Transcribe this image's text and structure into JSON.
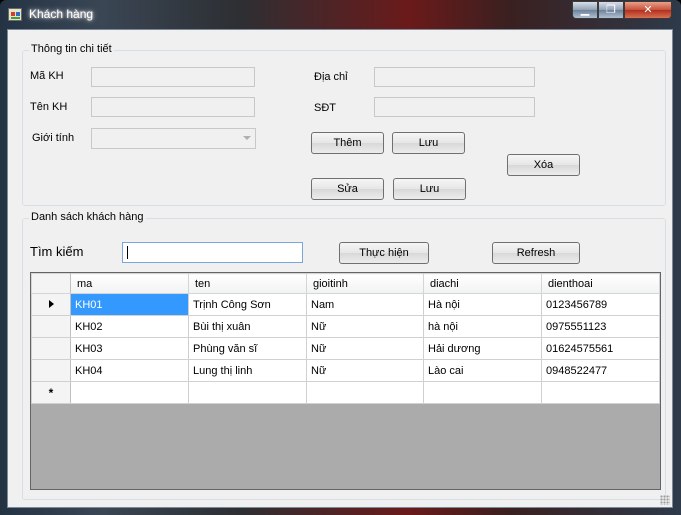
{
  "window": {
    "title": "Khách hàng",
    "caption_buttons": {
      "minimize": "▁",
      "maximize": "❐",
      "close": "✕"
    }
  },
  "details": {
    "group_title": "Thông tin chi tiết",
    "labels": {
      "ma_kh": "Mã KH",
      "ten_kh": "Tên KH",
      "gioi_tinh": "Giới tính",
      "dia_chi": "Địa chỉ",
      "sdt": "SĐT"
    },
    "values": {
      "ma_kh": "",
      "ten_kh": "",
      "gioi_tinh": "",
      "dia_chi": "",
      "sdt": ""
    },
    "buttons": {
      "them": "Thêm",
      "luu_top": "Lưu",
      "xoa": "Xóa",
      "sua": "Sửa",
      "luu_bottom": "Lưu"
    }
  },
  "list": {
    "group_title": "Danh sách khách hàng",
    "search_label": "Tìm kiếm",
    "search_value": "",
    "execute_button": "Thực hiện",
    "refresh_button": "Refresh",
    "columns": [
      "ma",
      "ten",
      "gioitinh",
      "diachi",
      "dienthoai"
    ],
    "rows": [
      [
        "KH01",
        "Trịnh Công Sơn",
        "Nam",
        "Hà nội",
        "0123456789"
      ],
      [
        "KH02",
        "Bùi thị xuân",
        "Nữ",
        "hà nội",
        "0975551123"
      ],
      [
        "KH03",
        "Phùng  văn sĩ",
        "Nữ",
        "Hải dương",
        "01624575561"
      ],
      [
        "KH04",
        "Lung thị linh",
        "Nữ",
        "Lào cai",
        "0948522477"
      ]
    ],
    "current_row_marker": "▶",
    "new_row_marker": "*"
  },
  "colors": {
    "selection": "#3399ff",
    "form_background": "#f0f0f0",
    "grid_empty_area": "#ababab"
  }
}
